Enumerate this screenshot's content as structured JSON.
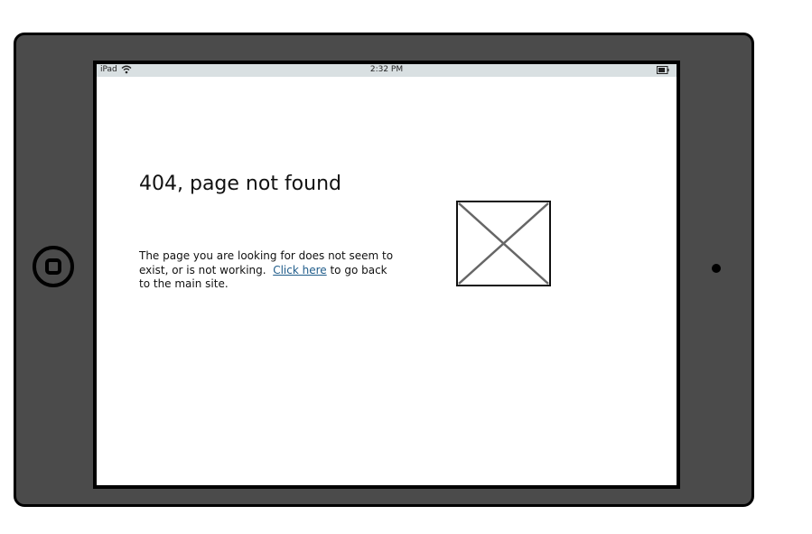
{
  "status_bar": {
    "device": "iPad",
    "time": "2:32 PM",
    "icons": [
      "wifi-icon",
      "battery-icon"
    ]
  },
  "main": {
    "title": "404, page not found",
    "message_before": "The page you are looking for does not seem to exist, or is not working.  ",
    "link_text": "Click here",
    "message_after": " to go back to the main site.",
    "image": "image-placeholder-icon"
  },
  "colors": {
    "device_frame": "#4b4b4b",
    "status_bar_bg": "#d9e0e2",
    "link": "#1f5c8a"
  }
}
